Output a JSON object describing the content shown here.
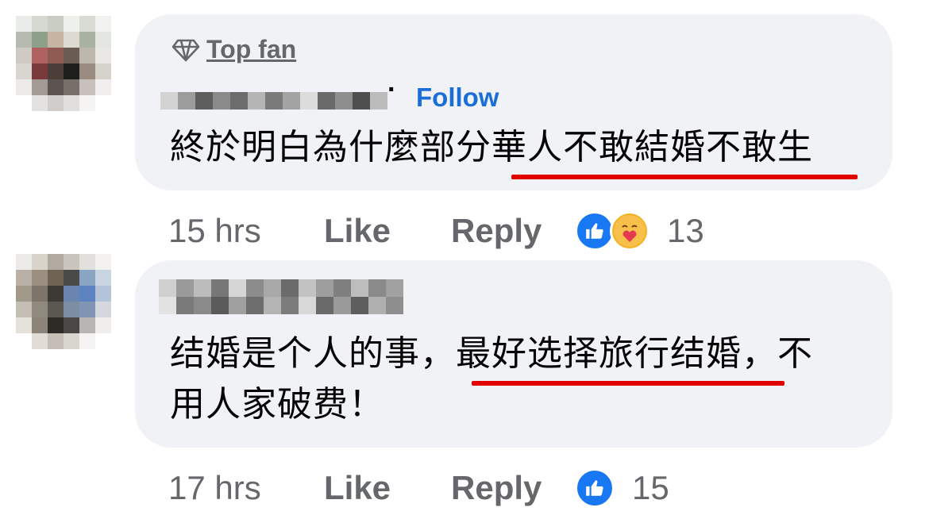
{
  "comments": [
    {
      "badge": "Top fan",
      "separator": "·",
      "follow_label": "Follow",
      "text": "終於明白為什麼部分華人不敢結婚不敢生",
      "time": "15 hrs",
      "like_label": "Like",
      "reply_label": "Reply",
      "reactions": [
        "like-icon",
        "care-icon"
      ],
      "reaction_count": "13"
    },
    {
      "text_line1": "结婚是个人的事，最好选择旅行结婚，不",
      "text_line2": "用人家破费！",
      "time": "17 hrs",
      "like_label": "Like",
      "reply_label": "Reply",
      "reactions": [
        "like-icon"
      ],
      "reaction_count": "15"
    }
  ],
  "colors": {
    "bubble": "#f0f2f5",
    "follow": "#1a6ed8",
    "muted": "#65676b",
    "underline_highlight": "#e00000",
    "like_blue": "#1877f2"
  }
}
